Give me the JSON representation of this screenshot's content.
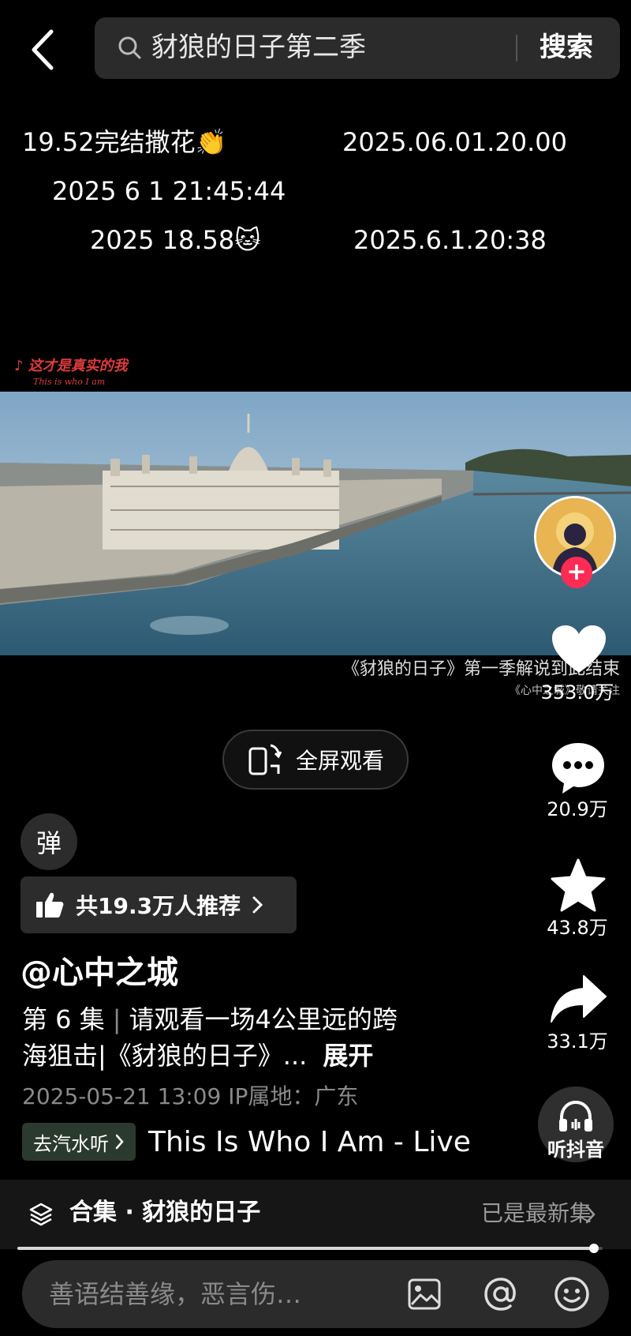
{
  "search": {
    "query": "豺狼的日子第二季",
    "submit_label": "搜索"
  },
  "overlay_comments": [
    "19.52完结撒花👏",
    "2025.06.01.20.00",
    "2025 6 1 21:45:44",
    "2025 18.58🐱",
    "2025.6.1.20:38"
  ],
  "video": {
    "music_caption": "♪ 这才是真实的我",
    "music_caption_en": "This is who I am",
    "subtitle": "《豺狼的日子》第一季解说到此结束",
    "subtitle_credit": "《心中之城》敬请关注"
  },
  "fullscreen_label": "全屏观看",
  "actions": {
    "likes": "353.0万",
    "comments": "20.9万",
    "favorites": "43.8万",
    "shares": "33.1万",
    "listen_label": "听抖音"
  },
  "danmaku_label": "弹",
  "recommend_label": "共19.3万人推荐",
  "post": {
    "author": "@心中之城",
    "episode": "第 6 集",
    "description_line1": "请观看一场4公里远的跨",
    "description_line2": "海狙击|《豺狼的日子》...",
    "expand_label": "展开",
    "meta": "2025-05-21 13:09  IP属地：广东"
  },
  "music": {
    "chip_label": "去汽水听",
    "title": "This Is Who I Am - Live"
  },
  "collection": {
    "title": "合集 · 豺狼的日子",
    "status": "已是最新集"
  },
  "progress": {
    "fraction": 0.985
  },
  "comment_input": {
    "placeholder": "善语结善缘，恶言伤…"
  },
  "colors": {
    "background": "#000000",
    "follow_accent": "#fe2c55",
    "music_caption": "#e23b3b"
  }
}
